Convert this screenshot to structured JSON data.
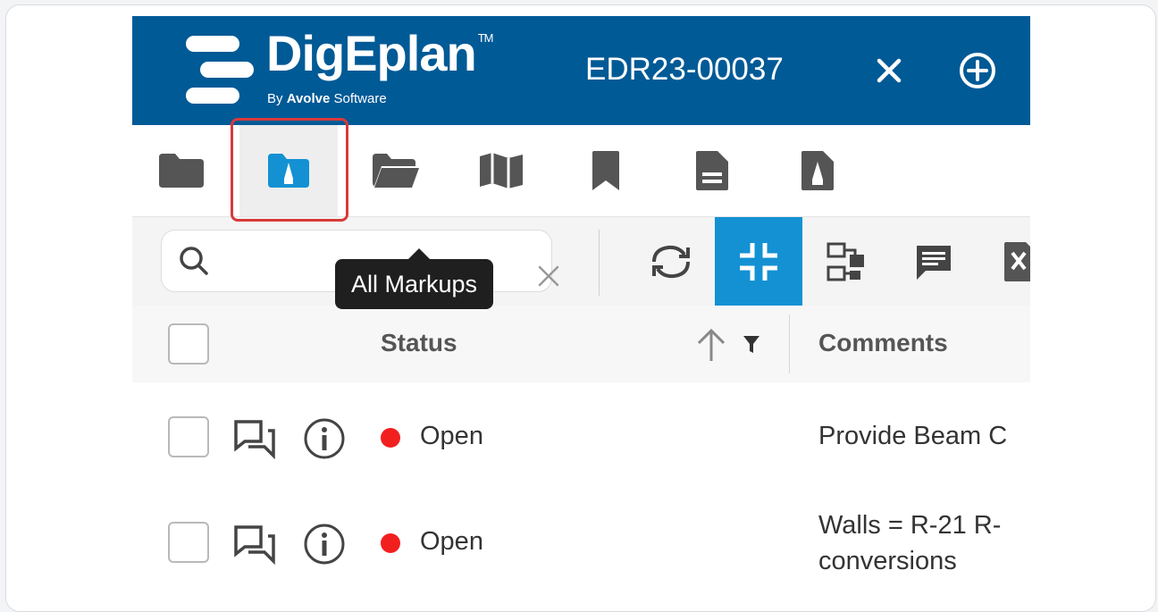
{
  "header": {
    "brand": "DigEplan",
    "trademark": "TM",
    "byline_prefix": "By ",
    "byline_company": "Avolve",
    "byline_suffix": " Software",
    "record_id": "EDR23-00037",
    "background_color": "#005a96"
  },
  "tabs": [
    {
      "icon": "folder-icon",
      "selected": false
    },
    {
      "icon": "markup-folder-icon",
      "selected": true
    },
    {
      "icon": "open-folder-icon",
      "selected": false
    },
    {
      "icon": "map-icon",
      "selected": false
    },
    {
      "icon": "bookmark-icon",
      "selected": false
    },
    {
      "icon": "document-icon",
      "selected": false
    },
    {
      "icon": "markup-document-icon",
      "selected": false
    }
  ],
  "tooltip": {
    "text": "All Markups"
  },
  "toolbar": {
    "search_value": "",
    "tools": [
      {
        "icon": "refresh-icon",
        "active": false
      },
      {
        "icon": "collapse-icon",
        "active": true
      },
      {
        "icon": "workflow-icon",
        "active": false
      },
      {
        "icon": "comment-icon",
        "active": false
      },
      {
        "icon": "excel-export-icon",
        "active": false
      }
    ],
    "accent_color": "#1391d3"
  },
  "grid": {
    "columns": [
      "Status",
      "Comments"
    ],
    "rows": [
      {
        "status": "Open",
        "status_color": "#f21f1f",
        "comment_line1": "Provide Beam C",
        "comment_line2": ""
      },
      {
        "status": "Open",
        "status_color": "#f21f1f",
        "comment_line1": "Walls = R-21 R-",
        "comment_line2": "conversions"
      }
    ]
  },
  "highlight_color": "#d83a3a"
}
